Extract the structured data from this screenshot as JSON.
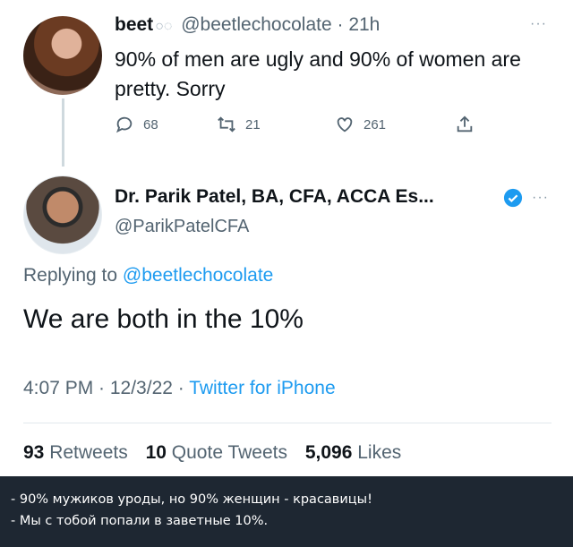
{
  "tweet1": {
    "name": "beet",
    "emoji": "○◌",
    "handle": "@beetlechocolate",
    "separator": "·",
    "time": "21h",
    "more": "···",
    "text": "90% of men are ugly and 90% of women are pretty. Sorry",
    "actions": {
      "replies": "68",
      "retweets": "21",
      "likes": "261"
    }
  },
  "tweet2": {
    "name": "Dr. Parik Patel, BA, CFA, ACCA Es...",
    "handle": "@ParikPatelCFA",
    "more": "···",
    "replying_prefix": "Replying to ",
    "replying_to": "@beetlechocolate",
    "text": "We are both in the 10%",
    "meta_time": "4:07 PM · 12/3/22 · ",
    "meta_source": "Twitter for iPhone",
    "stats": {
      "retweets_count": "93",
      "retweets_label": "Retweets",
      "quotes_count": "10",
      "quotes_label": "Quote Tweets",
      "likes_count": "5,096",
      "likes_label": "Likes"
    }
  },
  "caption": {
    "line1": "- 90% мужиков уроды, но 90% женщин - красавицы!",
    "line2": "- Мы с тобой попали в заветные 10%."
  },
  "colors": {
    "accent": "#1d9bf0",
    "muted": "#536471",
    "caption_bg": "#1e2732"
  },
  "icons": [
    "reply-icon",
    "retweet-icon",
    "like-icon",
    "share-icon",
    "verified-icon",
    "more-icon"
  ]
}
